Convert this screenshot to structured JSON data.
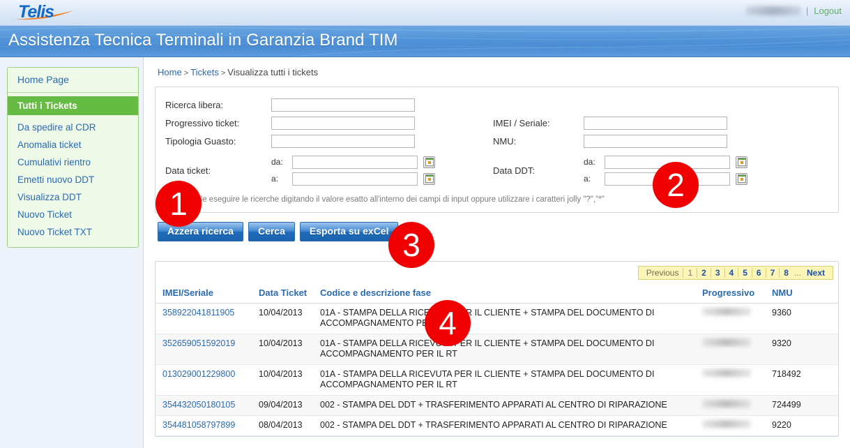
{
  "brand": {
    "logo_text": "Telis",
    "logo_accent_color": "#f47b20",
    "logo_color": "#1469c6"
  },
  "topbar": {
    "username_redacted": "",
    "separator": "|",
    "logout_label": "Logout"
  },
  "header": {
    "title": "Assistenza Tecnica Terminali in Garanzia Brand TIM"
  },
  "breadcrumb": {
    "items": [
      {
        "label": "Home",
        "link": true
      },
      {
        "label": "Tickets",
        "link": true
      },
      {
        "label": "Visualizza tutti i tickets",
        "link": false
      }
    ],
    "separator": ">"
  },
  "sidebar": {
    "home_label": "Home Page",
    "items": [
      {
        "label": "Tutti i Tickets",
        "active": true
      },
      {
        "label": "Da spedire al CDR",
        "active": false
      },
      {
        "label": "Anomalia ticket",
        "active": false
      },
      {
        "label": "Cumulativi rientro",
        "active": false
      },
      {
        "label": "Emetti nuovo DDT",
        "active": false
      },
      {
        "label": "Visualizza DDT",
        "active": false
      },
      {
        "label": "Nuovo Ticket",
        "active": false
      },
      {
        "label": "Nuovo Ticket TXT",
        "active": false
      }
    ]
  },
  "search_form": {
    "fields": {
      "ricerca_libera": {
        "label": "Ricerca libera:",
        "value": "",
        "placeholder": ""
      },
      "progressivo_ticket": {
        "label": "Progressivo ticket:",
        "value": "",
        "placeholder": ""
      },
      "tipologia_guasto": {
        "label": "Tipologia Guasto:",
        "value": "",
        "placeholder": ""
      },
      "data_ticket": {
        "label": "Data ticket:",
        "from_label": "da:",
        "from_value": "",
        "to_label": "a:",
        "to_value": ""
      },
      "imei_seriale": {
        "label": "IMEI / Seriale:",
        "value": "",
        "placeholder": ""
      },
      "nmu": {
        "label": "NMU:",
        "value": "",
        "placeholder": ""
      },
      "data_ddt": {
        "label": "Data DDT:",
        "from_label": "da:",
        "from_value": "",
        "to_label": "a:",
        "to_value": ""
      }
    },
    "calendar_icon": "calendar-icon",
    "hint": "È possibile eseguire le ricerche digitando il valore esatto all'interno dei campi di input oppure utilizzare i caratteri jolly \"?\",\"*\""
  },
  "buttons": {
    "reset_label": "Azzera ricerca",
    "search_label": "Cerca",
    "export_label": "Esporta su exCel"
  },
  "pagination": {
    "previous_label": "Previous",
    "pages": [
      "1",
      "2",
      "3",
      "4",
      "5",
      "6",
      "7",
      "8"
    ],
    "current_page": "1",
    "ellipsis": "...",
    "next_label": "Next"
  },
  "results_table": {
    "columns": [
      "IMEI/Seriale",
      "Data Ticket",
      "Codice e descrizione fase",
      "Progressivo",
      "NMU"
    ],
    "rows": [
      {
        "imei": "358922041811905",
        "data_ticket": "10/04/2013",
        "fase": "01A - STAMPA DELLA RICEVUTA PER IL CLIENTE + STAMPA DEL DOCUMENTO DI ACCOMPAGNAMENTO PER IL RT",
        "progressivo": "",
        "nmu": "9360"
      },
      {
        "imei": "352659051592019",
        "data_ticket": "10/04/2013",
        "fase": "01A - STAMPA DELLA RICEVUTA PER IL CLIENTE + STAMPA DEL DOCUMENTO DI ACCOMPAGNAMENTO PER IL RT",
        "progressivo": "",
        "nmu": "9320"
      },
      {
        "imei": "013029001229800",
        "data_ticket": "10/04/2013",
        "fase": "01A - STAMPA DELLA RICEVUTA PER IL CLIENTE + STAMPA DEL DOCUMENTO DI ACCOMPAGNAMENTO PER IL RT",
        "progressivo": "",
        "nmu": "718492"
      },
      {
        "imei": "354432050180105",
        "data_ticket": "09/04/2013",
        "fase": "002 - STAMPA DEL DDT + TRASFERIMENTO APPARATI AL CENTRO DI RIPARAZIONE",
        "progressivo": "",
        "nmu": "724499"
      },
      {
        "imei": "354481058797899",
        "data_ticket": "08/04/2013",
        "fase": "002 - STAMPA DEL DDT + TRASFERIMENTO APPARATI AL CENTRO DI RIPARAZIONE",
        "progressivo": "",
        "nmu": "9220"
      }
    ]
  },
  "annotations": {
    "badges": [
      "1",
      "2",
      "3",
      "4"
    ],
    "color": "#f00000"
  }
}
